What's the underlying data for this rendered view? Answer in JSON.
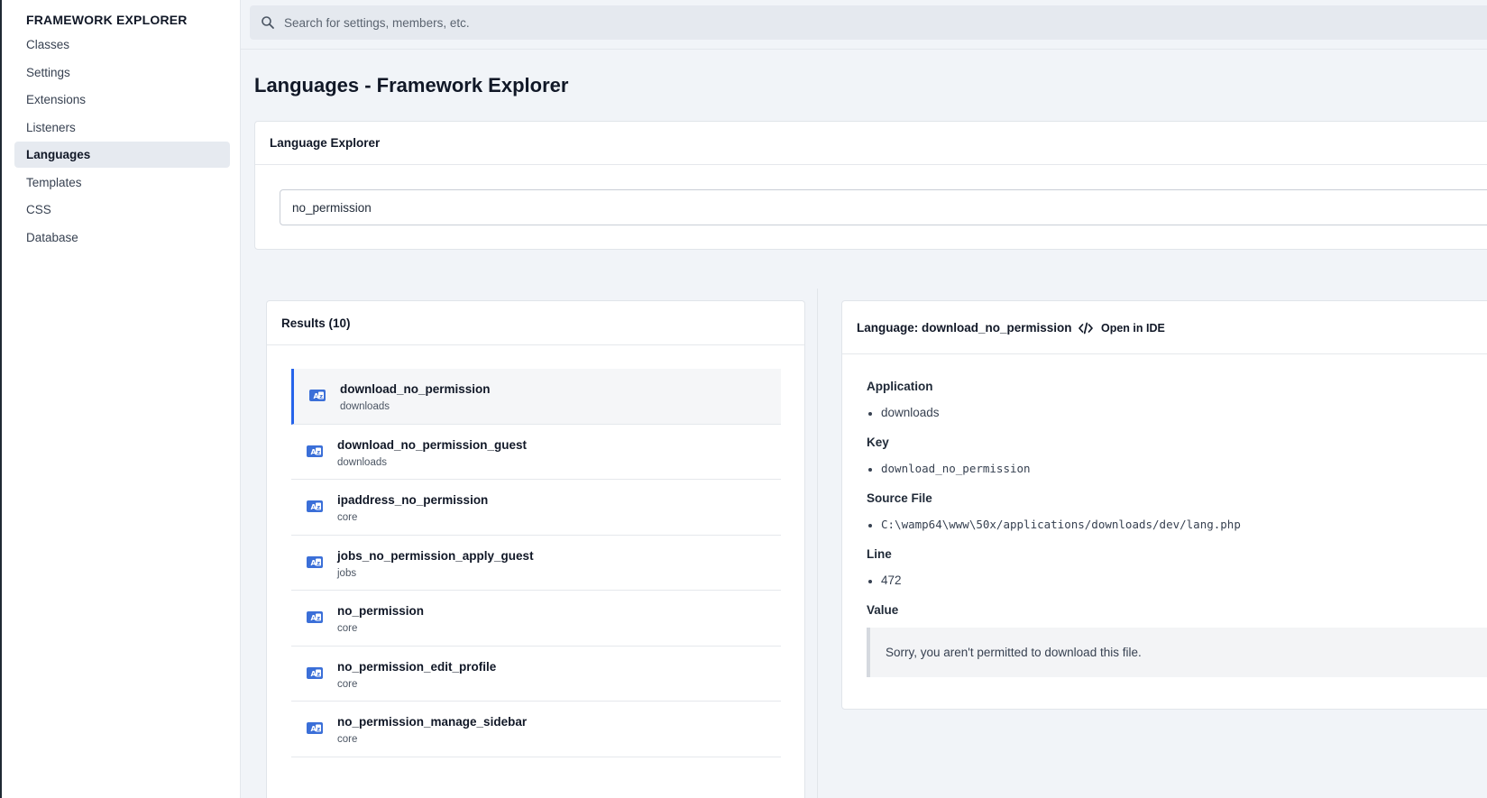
{
  "sidebar": {
    "brand": "FRAMEWORK EXPLORER",
    "items": [
      {
        "label": "Classes",
        "active": false
      },
      {
        "label": "Settings",
        "active": false
      },
      {
        "label": "Extensions",
        "active": false
      },
      {
        "label": "Listeners",
        "active": false
      },
      {
        "label": "Languages",
        "active": true
      },
      {
        "label": "Templates",
        "active": false
      },
      {
        "label": "CSS",
        "active": false
      },
      {
        "label": "Database",
        "active": false
      }
    ]
  },
  "search": {
    "placeholder": "Search for settings, members, etc.",
    "icon": "search-icon"
  },
  "page": {
    "title": "Languages - Framework Explorer"
  },
  "explorer": {
    "title": "Language Explorer",
    "input_value": "no_permission"
  },
  "results": {
    "title": "Results (10)",
    "items": [
      {
        "key": "download_no_permission",
        "app": "downloads",
        "active": true
      },
      {
        "key": "download_no_permission_guest",
        "app": "downloads",
        "active": false
      },
      {
        "key": "ipaddress_no_permission",
        "app": "core",
        "active": false
      },
      {
        "key": "jobs_no_permission_apply_guest",
        "app": "jobs",
        "active": false
      },
      {
        "key": "no_permission",
        "app": "core",
        "active": false
      },
      {
        "key": "no_permission_edit_profile",
        "app": "core",
        "active": false
      },
      {
        "key": "no_permission_manage_sidebar",
        "app": "core",
        "active": false
      }
    ]
  },
  "detail": {
    "title": "Language: download_no_permission",
    "open_ide_label": "Open in IDE",
    "application_label": "Application",
    "application_value": "downloads",
    "key_label": "Key",
    "key_value": "download_no_permission",
    "source_label": "Source File",
    "source_value": "C:\\wamp64\\www\\50x/applications/downloads/dev/lang.php",
    "line_label": "Line",
    "line_value": "472",
    "value_label": "Value",
    "value_text": "Sorry, you aren't permitted to download this file."
  },
  "colors": {
    "accent": "#2563eb",
    "icon_blue": "#3b6fd8"
  }
}
